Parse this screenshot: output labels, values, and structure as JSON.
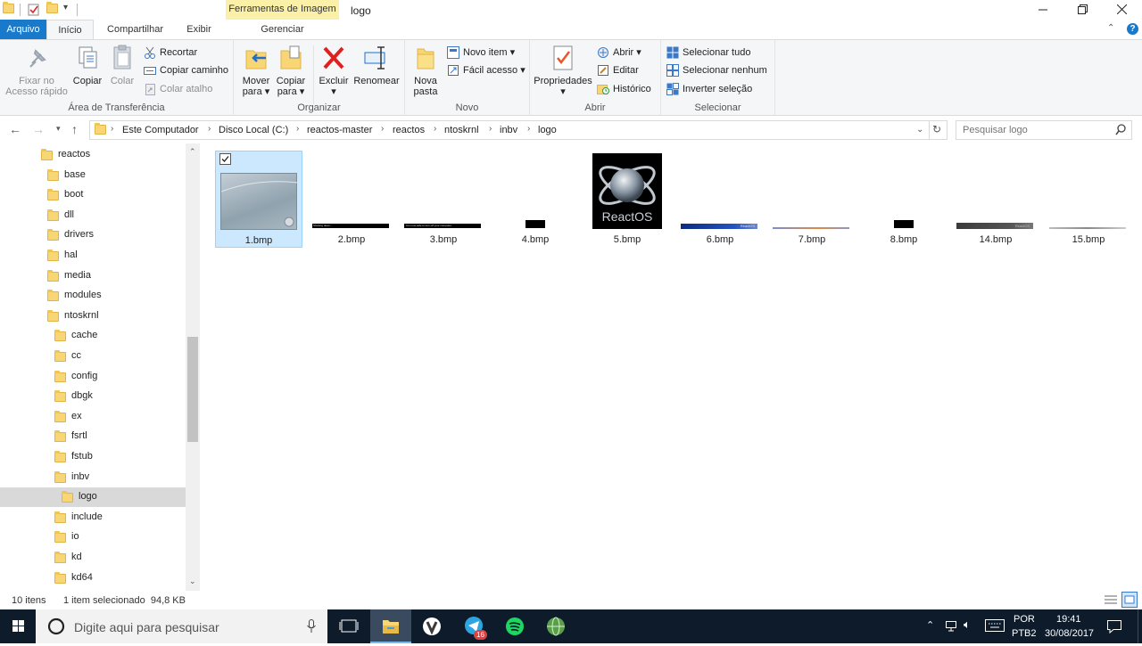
{
  "window": {
    "title": "logo",
    "context_tab": "Ferramentas de Imagem",
    "controls": [
      "minimize",
      "restore",
      "close"
    ]
  },
  "tabs": [
    {
      "label": "Arquivo"
    },
    {
      "label": "Início"
    },
    {
      "label": "Compartilhar"
    },
    {
      "label": "Exibir"
    },
    {
      "label": "Gerenciar"
    }
  ],
  "ribbon": {
    "clipboard": {
      "group": "Área de Transferência",
      "pin_line1": "Fixar no",
      "pin_line2": "Acesso rápido",
      "copy": "Copiar",
      "paste": "Colar",
      "cut": "Recortar",
      "copy_path": "Copiar caminho",
      "paste_shortcut": "Colar atalho"
    },
    "organize": {
      "group": "Organizar",
      "move_line1": "Mover",
      "move_line2": "para",
      "copyto_line1": "Copiar",
      "copyto_line2": "para",
      "delete": "Excluir",
      "rename": "Renomear"
    },
    "new": {
      "group": "Novo",
      "folder_line1": "Nova",
      "folder_line2": "pasta",
      "new_item": "Novo item",
      "easy_access": "Fácil acesso"
    },
    "open": {
      "group": "Abrir",
      "properties": "Propriedades",
      "open": "Abrir",
      "edit": "Editar",
      "history": "Histórico"
    },
    "select": {
      "group": "Selecionar",
      "all": "Selecionar tudo",
      "none": "Selecionar nenhum",
      "invert": "Inverter seleção"
    }
  },
  "address": {
    "crumbs": [
      "Este Computador",
      "Disco Local (C:)",
      "reactos-master",
      "reactos",
      "ntoskrnl",
      "inbv",
      "logo"
    ],
    "search_placeholder": "Pesquisar logo"
  },
  "tree": [
    {
      "label": "reactos"
    },
    {
      "label": "base"
    },
    {
      "label": "boot"
    },
    {
      "label": "dll"
    },
    {
      "label": "drivers"
    },
    {
      "label": "hal"
    },
    {
      "label": "media"
    },
    {
      "label": "modules"
    },
    {
      "label": "ntoskrnl"
    },
    {
      "label": "cache"
    },
    {
      "label": "cc"
    },
    {
      "label": "config"
    },
    {
      "label": "dbgk"
    },
    {
      "label": "ex"
    },
    {
      "label": "fsrtl"
    },
    {
      "label": "fstub"
    },
    {
      "label": "inbv"
    },
    {
      "label": "logo"
    },
    {
      "label": "include"
    },
    {
      "label": "io"
    },
    {
      "label": "kd"
    },
    {
      "label": "kd64"
    }
  ],
  "files": [
    {
      "name": "1.bmp"
    },
    {
      "name": "2.bmp",
      "thumb_text": "Shutting down..."
    },
    {
      "name": "3.bmp",
      "thumb_text": "It is now safe to turn off your computer."
    },
    {
      "name": "4.bmp"
    },
    {
      "name": "5.bmp",
      "thumb_text": "ReactOS"
    },
    {
      "name": "6.bmp",
      "thumb_text": "ReactOS"
    },
    {
      "name": "7.bmp"
    },
    {
      "name": "8.bmp"
    },
    {
      "name": "14.bmp",
      "thumb_text": "ReactOS"
    },
    {
      "name": "15.bmp"
    }
  ],
  "status": {
    "count": "10 itens",
    "selection": "1 item selecionado  94,8 KB"
  },
  "taskbar": {
    "search_placeholder": "Digite aqui para pesquisar",
    "lang1": "POR",
    "lang2": "PTB2",
    "time": "19:41",
    "date": "30/08/2017",
    "telegram_badge": "16"
  },
  "colors": {
    "accent": "#1979ca",
    "selection": "#cce8ff",
    "folder": "#f8d675",
    "taskbar": "#0d1b2b"
  }
}
